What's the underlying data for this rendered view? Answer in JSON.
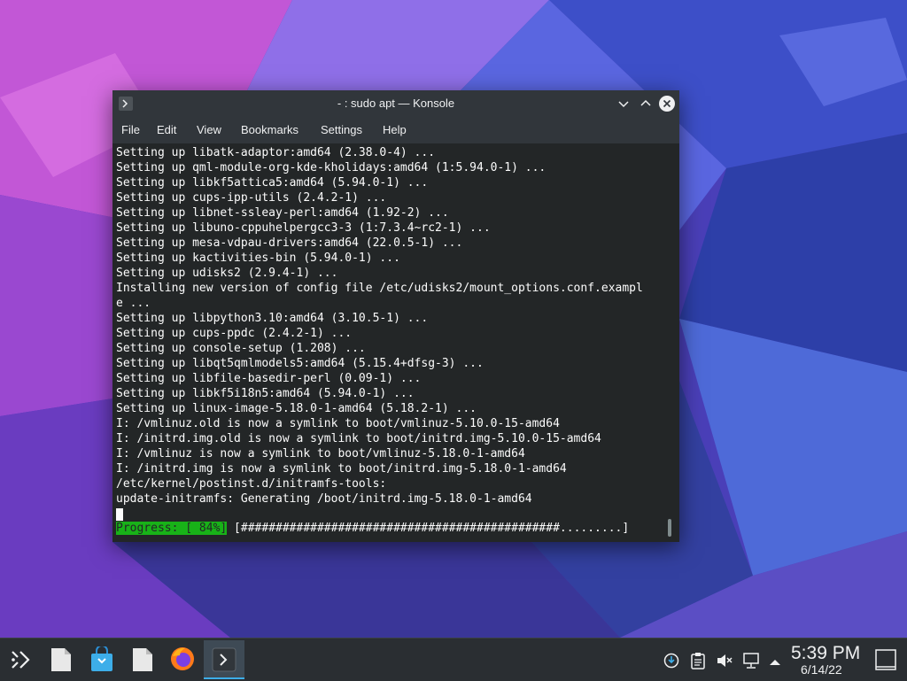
{
  "window": {
    "title": "- : sudo apt — Konsole"
  },
  "menu": [
    "File",
    "Edit",
    "View",
    "Bookmarks",
    "Settings",
    "Help"
  ],
  "terminal": {
    "lines": [
      "Setting up libatk-adaptor:amd64 (2.38.0-4) ...",
      "Setting up qml-module-org-kde-kholidays:amd64 (1:5.94.0-1) ...",
      "Setting up libkf5attica5:amd64 (5.94.0-1) ...",
      "Setting up cups-ipp-utils (2.4.2-1) ...",
      "Setting up libnet-ssleay-perl:amd64 (1.92-2) ...",
      "Setting up libuno-cppuhelpergcc3-3 (1:7.3.4~rc2-1) ...",
      "Setting up mesa-vdpau-drivers:amd64 (22.0.5-1) ...",
      "Setting up kactivities-bin (5.94.0-1) ...",
      "Setting up udisks2 (2.9.4-1) ...",
      "Installing new version of config file /etc/udisks2/mount_options.conf.exampl",
      "e ...",
      "Setting up libpython3.10:amd64 (3.10.5-1) ...",
      "Setting up cups-ppdc (2.4.2-1) ...",
      "Setting up console-setup (1.208) ...",
      "Setting up libqt5qmlmodels5:amd64 (5.15.4+dfsg-3) ...",
      "Setting up libfile-basedir-perl (0.09-1) ...",
      "Setting up libkf5i18n5:amd64 (5.94.0-1) ...",
      "Setting up linux-image-5.18.0-1-amd64 (5.18.2-1) ...",
      "I: /vmlinuz.old is now a symlink to boot/vmlinuz-5.10.0-15-amd64",
      "I: /initrd.img.old is now a symlink to boot/initrd.img-5.10.0-15-amd64",
      "I: /vmlinuz is now a symlink to boot/vmlinuz-5.18.0-1-amd64",
      "I: /initrd.img is now a symlink to boot/initrd.img-5.18.0-1-amd64",
      "/etc/kernel/postinst.d/initramfs-tools:",
      "update-initramfs: Generating /boot/initrd.img-5.18.0-1-amd64"
    ],
    "progress_label": "Progress: [ 84%]",
    "progress_bar": " [##############################################.........]"
  },
  "taskbar": {
    "icons": [
      "app-launcher-icon",
      "document-icon",
      "discover-store-icon",
      "document-icon",
      "firefox-icon",
      "konsole-icon"
    ],
    "tray_icons": [
      "updates-icon",
      "clipboard-icon",
      "volume-muted-icon",
      "network-icon",
      "expand-tray-icon"
    ],
    "clock_time": "5:39 PM",
    "clock_date": "6/14/22"
  },
  "colors": {
    "progress_green": "#18b218",
    "accent": "#3daee9",
    "terminal_bg": "#232627"
  }
}
